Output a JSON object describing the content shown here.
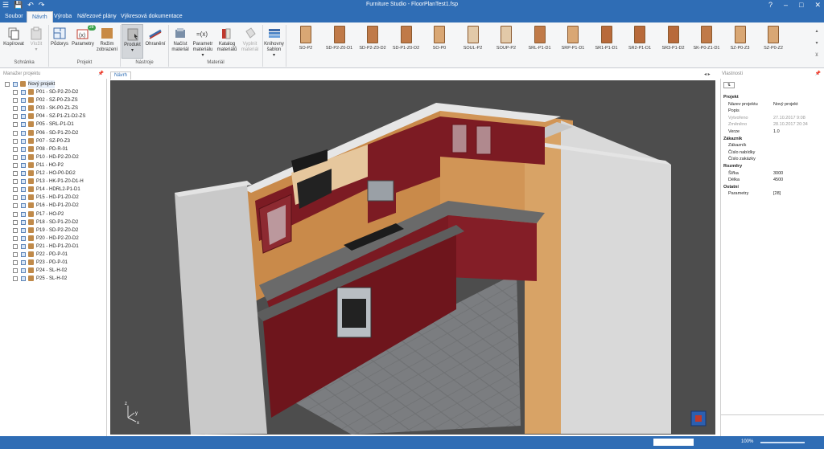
{
  "title": "Furniture Studio - FloorPlanTest1.fsp",
  "tabs": [
    {
      "label": "Soubor"
    },
    {
      "label": "Návrh"
    },
    {
      "label": "Výroba"
    },
    {
      "label": "Nářezové plány"
    },
    {
      "label": "Výkresová dokumentace"
    }
  ],
  "ribbon": {
    "copy": "Kopírovat",
    "paste": "Vložit",
    "clipboard_group": "Schránka",
    "floorplan": "Půdorys",
    "params": "Parametry",
    "params_badge": "28",
    "display": "Režim zobrazení",
    "project_group": "Projekt",
    "product": "Produkt",
    "protect": "Ohranění",
    "tools_group": "Nástroje",
    "load_material": "Načíst materiál",
    "material_params": "Parametr materiálu",
    "catalog": "Katalog materiálů",
    "clear_material": "Vyplnit materiál",
    "material_group": "Materiál",
    "library": "Knihovny šablon"
  },
  "gallery": [
    {
      "label": "SO-P2",
      "color": "#d9a774"
    },
    {
      "label": "SD-P2-Z0-D1",
      "color": "#c07a48"
    },
    {
      "label": "SD-P2-Z0-D2",
      "color": "#c07a48"
    },
    {
      "label": "SD-P1-Z0-D2",
      "color": "#c07a48"
    },
    {
      "label": "SO-P0",
      "color": "#d9a774"
    },
    {
      "label": "SOUL-P2",
      "color": "#e2c9a8"
    },
    {
      "label": "SOUP-P2",
      "color": "#e2c9a8"
    },
    {
      "label": "SRL-P1-D1",
      "color": "#c07a48"
    },
    {
      "label": "SRP-P1-D1",
      "color": "#d9a774"
    },
    {
      "label": "SR1-P1-D1",
      "color": "#b86a3a"
    },
    {
      "label": "SR2-P1-D1",
      "color": "#b86a3a"
    },
    {
      "label": "SR3-P1-D2",
      "color": "#b86a3a"
    },
    {
      "label": "SK-P0-Z1-D1",
      "color": "#c07a48"
    },
    {
      "label": "SZ-P0-Z3",
      "color": "#d9a774"
    },
    {
      "label": "SZ-P0-Z2",
      "color": "#d9a774"
    }
  ],
  "project_manager": {
    "title": "Manažer projektu",
    "root": "Nový projekt",
    "items": [
      "P01 - SD-P2-Z0-D2",
      "P02 - SZ-P0-Z3-ZS",
      "P03 - SK-P0-Z1-ZS",
      "P04 - SZ-P1-Z1-D2-ZS",
      "P05 - SRL-P1-D1",
      "P06 - SD-P1-Z0-D2",
      "P07 - SZ-P0-Z3",
      "P08 - PD-R-01",
      "P10 - HD-P2-Z0-D2",
      "P11 - HO-P2",
      "P12 - HO-P0-DG2",
      "P13 - HK-P1-Z0-D1-H",
      "P14 - HDRL2-P1-D1",
      "P15 - HD-P1-Z0-D2",
      "P16 - HD-P1-Z0-D2",
      "P17 - HO-P2",
      "P18 - SD-P1-Z0-D2",
      "P19 - SD-P2-Z0-D2",
      "P20 - HD-P2-Z0-D2",
      "P21 - HD-P1-Z0-D1",
      "P22 - PD-P-01",
      "P23 - PD-P-01",
      "P24 - SL-H-02",
      "P25 - SL-H-02"
    ]
  },
  "view_tab": "Návrh",
  "properties": {
    "title": "Vlastnosti",
    "rows": [
      {
        "k": "Projekt",
        "v": "",
        "bold": true
      },
      {
        "k": "Název projektu",
        "v": "Nový projekt"
      },
      {
        "k": "Popis",
        "v": ""
      },
      {
        "k": "Vytvořeno",
        "v": "27.10.2017 9:08",
        "muted": true
      },
      {
        "k": "Změněno",
        "v": "28.10.2017 20:34",
        "muted": true
      },
      {
        "k": "Verze",
        "v": "1.0"
      },
      {
        "k": "Zákazník",
        "v": "",
        "bold": true
      },
      {
        "k": "Zákazník",
        "v": ""
      },
      {
        "k": "Číslo nabídky",
        "v": ""
      },
      {
        "k": "Číslo zakázky",
        "v": ""
      },
      {
        "k": "Rozměry",
        "v": "",
        "bold": true
      },
      {
        "k": "Šířka",
        "v": "3000"
      },
      {
        "k": "Délka",
        "v": "4500"
      },
      {
        "k": "Ostatní",
        "v": "",
        "bold": true
      },
      {
        "k": "Parametry",
        "v": "[28]"
      }
    ]
  },
  "status": {
    "zoom": "100%"
  },
  "axes": {
    "z": "z",
    "x": "x",
    "y": "y"
  }
}
